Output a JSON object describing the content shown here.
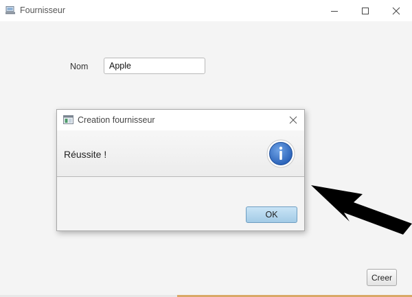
{
  "window": {
    "title": "Fournisseur",
    "icon": "app-computer-icon",
    "controls": [
      "minimize-icon",
      "maximize-icon",
      "close-icon"
    ]
  },
  "form": {
    "nom_label": "Nom",
    "nom_value": "Apple",
    "creer_label": "Creer"
  },
  "dialog": {
    "title": "Creation fournisseur",
    "icon": "dialog-window-icon",
    "message": "Réussite !",
    "info_icon": "information-icon",
    "ok_label": "OK"
  },
  "annotation": {
    "arrow": "black-arrow-pointing-up-left",
    "color": "#000000"
  },
  "colors": {
    "accent_stripe": "#d9a866",
    "ok_button": "#a3cbe6",
    "info_icon": "#2f6dc6"
  }
}
